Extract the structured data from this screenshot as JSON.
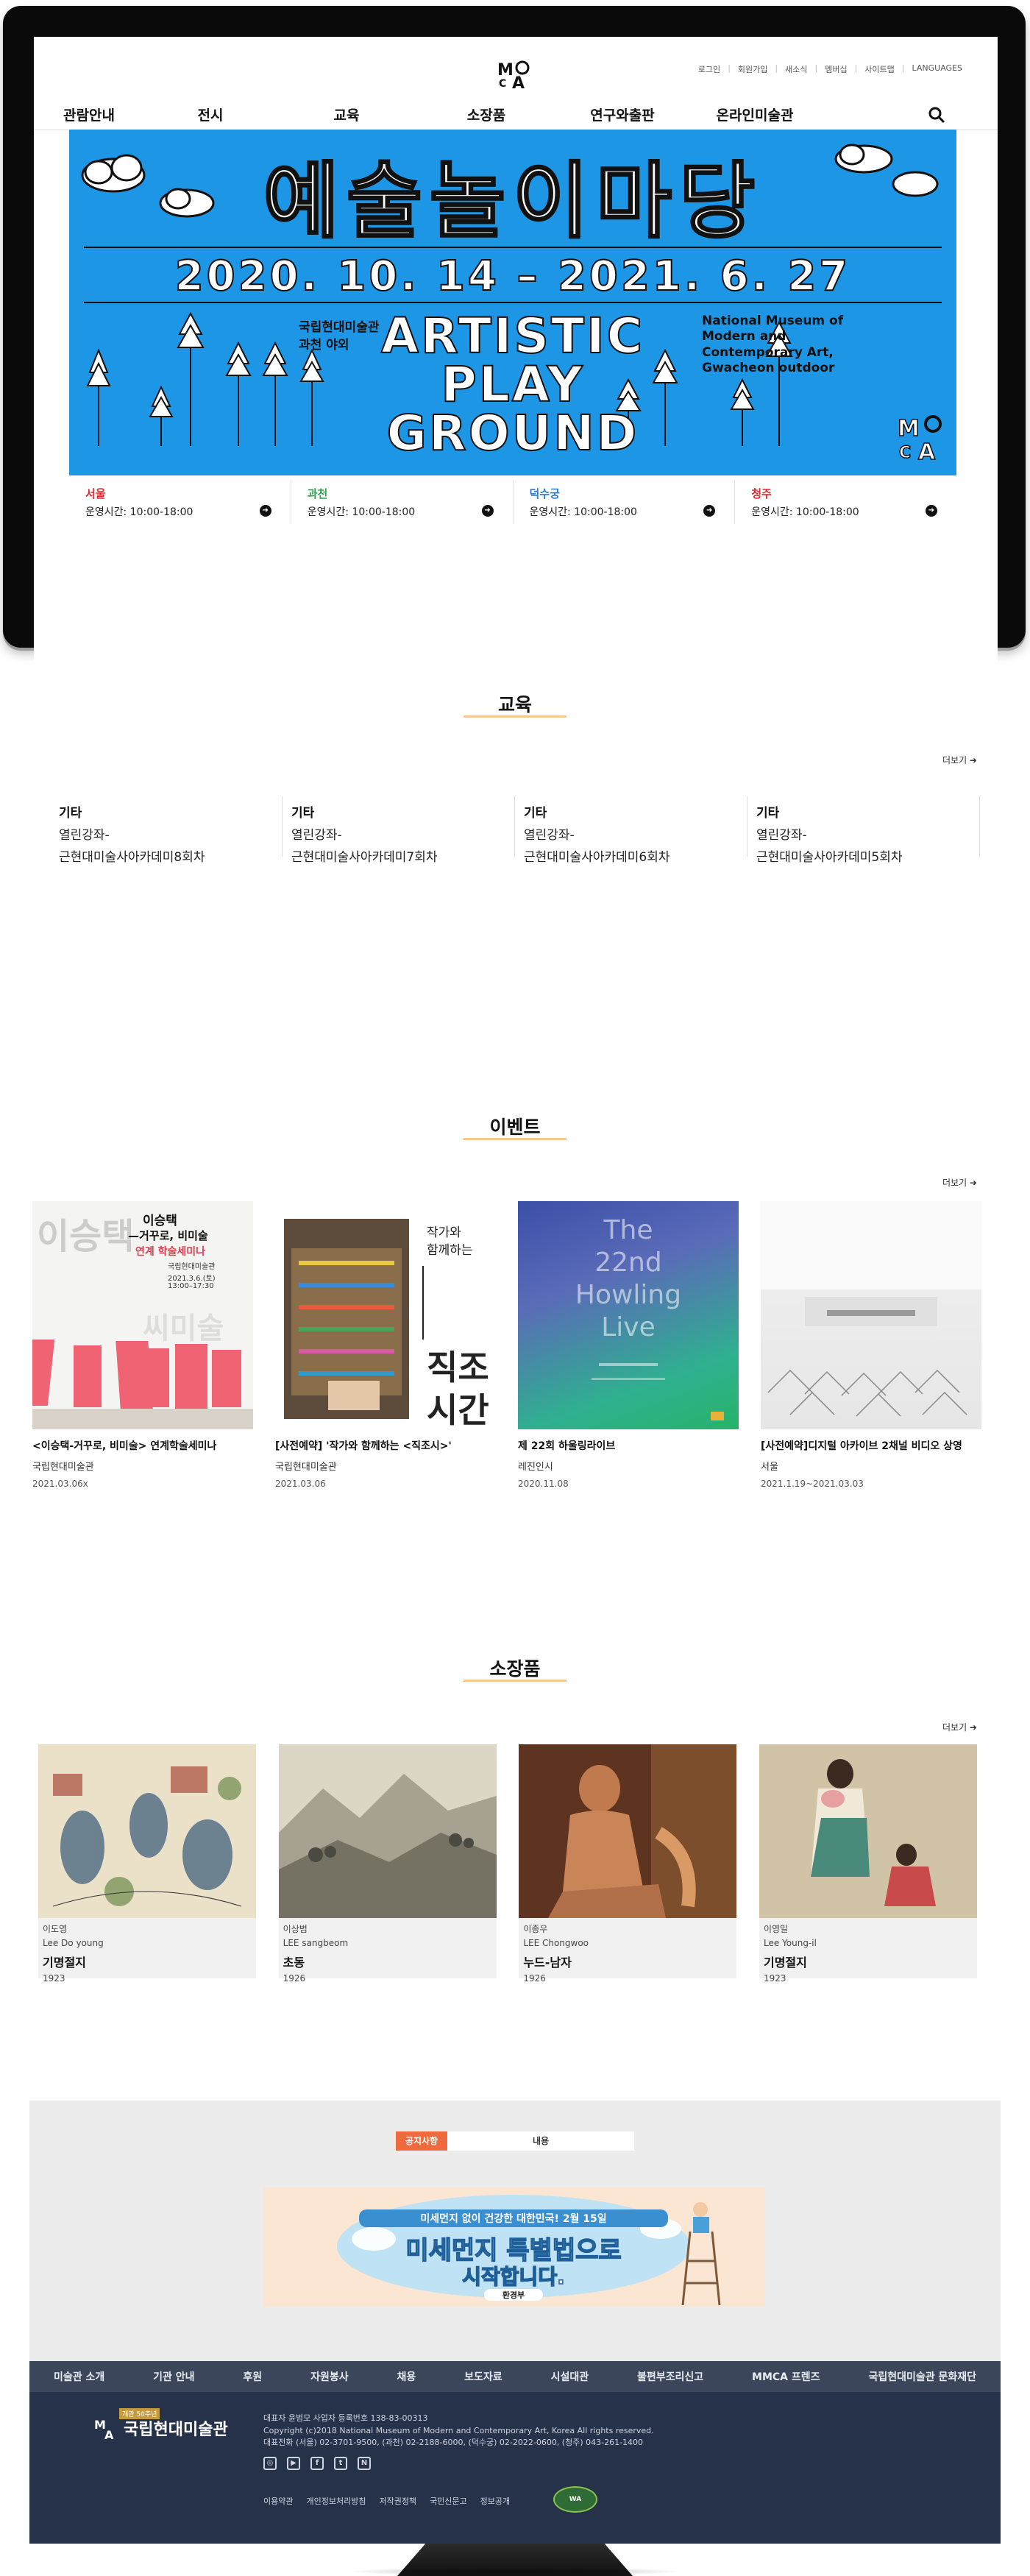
{
  "header": {
    "utility_links": [
      "로그인",
      "회원가입",
      "새소식",
      "멤버십",
      "사이트맵",
      "LANGUAGES"
    ],
    "logo_text": "MMCA",
    "menu": [
      "관람안내",
      "전시",
      "교육",
      "소장품",
      "연구와출판",
      "온라인미술관"
    ]
  },
  "banner": {
    "title": "예술놀이마당",
    "dates": "2020. 10. 14 – 2021. 6. 27",
    "venue_kr": "국립현대미술관\n과천 야외",
    "title_en": "ARTISTIC\nPLAY\nGROUND",
    "venue_en": "National Museum of\nModern and\nContemporary Art,\nGwacheon outdoor",
    "colors": {
      "background": "#1e96e6",
      "stroke": "#111111"
    }
  },
  "hours": [
    {
      "city": "서울",
      "color": "#e3262f",
      "time": "운영시간: 10:00-18:00"
    },
    {
      "city": "과천",
      "color": "#2aa84a",
      "time": "운영시간: 10:00-18:00"
    },
    {
      "city": "덕수궁",
      "color": "#2b7bd6",
      "time": "운영시간: 10:00-18:00"
    },
    {
      "city": "청주",
      "color": "#e3262f",
      "time": "운영시간: 10:00-18:00"
    }
  ],
  "education": {
    "title": "교육",
    "more": "더보기 ➜",
    "items": [
      {
        "category": "기타",
        "line1": "열린강좌-",
        "line2": "근현대미술사아카데미8회차"
      },
      {
        "category": "기타",
        "line1": "열린강좌-",
        "line2": "근현대미술사아카데미7회차"
      },
      {
        "category": "기타",
        "line1": "열린강좌-",
        "line2": "근현대미술사아카데미6회차"
      },
      {
        "category": "기타",
        "line1": "열린강좌-",
        "line2": "근현대미술사아카데미5회차"
      }
    ]
  },
  "events": {
    "title": "이벤트",
    "more": "더보기 ➜",
    "items": [
      {
        "title": "<이승택-거꾸로, 비미술> 연계학술세미나",
        "sub": "국립현대미술관",
        "date": "2021.03.06x",
        "poster": {
          "big": "이승택",
          "line1": "—거꾸로, 비미술",
          "line2": "연계 학술세미나",
          "line3": "국립현대미술관",
          "line4": "2021.3.6.(토)",
          "line5": "13:00–17:30"
        }
      },
      {
        "title": "[사전예약] '작가와 함께하는 <직조시>'",
        "sub": "국립현대미술관",
        "date": "2021.03.06",
        "poster": {
          "small1": "작가와",
          "small2": "함께하는",
          "big1": "직조",
          "big2": "시간"
        }
      },
      {
        "title": "제 22회 하울링라이브",
        "sub": "레진인시",
        "date": "2020.11.08",
        "poster": {
          "line1": "The",
          "line2": "22nd",
          "line3": "Howling",
          "line4": "Live"
        }
      },
      {
        "title": "[사전예약]디지털 아카이브 2채널 비디오 상영",
        "sub": "서울",
        "date": "2021.1.19~2021.03.03",
        "poster": {}
      }
    ]
  },
  "collection": {
    "title": "소장품",
    "more": "더보기 ➜",
    "items": [
      {
        "artist_kr": "이도영",
        "artist_en": "Lee Do young",
        "title": "기명절지",
        "year": "1923"
      },
      {
        "artist_kr": "이상범",
        "artist_en": "LEE sangbeom",
        "title": "초동",
        "year": "1926"
      },
      {
        "artist_kr": "이종우",
        "artist_en": "LEE Chongwoo",
        "title": "누드-남자",
        "year": "1926"
      },
      {
        "artist_kr": "이영일",
        "artist_en": "Lee Young-il",
        "title": "기명절지",
        "year": "1923"
      }
    ]
  },
  "notice": {
    "tab_active": "공지사항",
    "tab_other": "내용",
    "banner": {
      "top": "미세먼지 없이 건강한 대한민국! 2월 15일",
      "main": "미세먼지 특별법으로",
      "main2": "시작합니다.",
      "ministry": "환경부"
    }
  },
  "footer": {
    "nav": [
      "미술관 소개",
      "기관 안내",
      "후원",
      "자원봉사",
      "채용",
      "보도자료",
      "시설대관",
      "불편부조리신고",
      "MMCA 프렌즈",
      "국립현대미술관 문화재단"
    ],
    "logo_name": "국립현대미술관",
    "logo_tag": "개관 50주년",
    "info1": "대표자 윤범모 사업자 등록번호 138-83-00313",
    "info2": "Copyright (c)2018 National Museum of Modern and Contemporary Art, Korea All rights reserved.",
    "info3": "대표전화 (서울) 02-3701-9500, (과천) 02-2188-6000, (덕수궁) 02-2022-0600, (청주) 043-261-1400",
    "social": [
      "◎",
      "▶",
      "f",
      "t",
      "N"
    ],
    "links": [
      "이용약관",
      "개인정보처리방침",
      "저작권정책",
      "국민신문고",
      "정보공개"
    ],
    "badge": "WA"
  }
}
